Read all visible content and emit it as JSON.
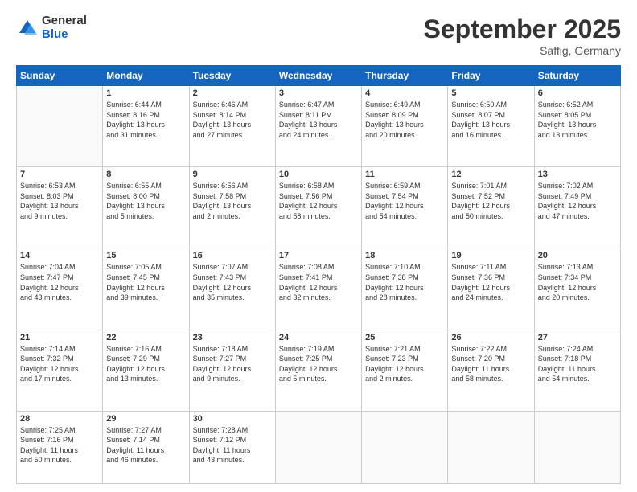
{
  "logo": {
    "general": "General",
    "blue": "Blue"
  },
  "title": "September 2025",
  "location": "Saffig, Germany",
  "days_header": [
    "Sunday",
    "Monday",
    "Tuesday",
    "Wednesday",
    "Thursday",
    "Friday",
    "Saturday"
  ],
  "weeks": [
    [
      {
        "day": "",
        "info": ""
      },
      {
        "day": "1",
        "info": "Sunrise: 6:44 AM\nSunset: 8:16 PM\nDaylight: 13 hours\nand 31 minutes."
      },
      {
        "day": "2",
        "info": "Sunrise: 6:46 AM\nSunset: 8:14 PM\nDaylight: 13 hours\nand 27 minutes."
      },
      {
        "day": "3",
        "info": "Sunrise: 6:47 AM\nSunset: 8:11 PM\nDaylight: 13 hours\nand 24 minutes."
      },
      {
        "day": "4",
        "info": "Sunrise: 6:49 AM\nSunset: 8:09 PM\nDaylight: 13 hours\nand 20 minutes."
      },
      {
        "day": "5",
        "info": "Sunrise: 6:50 AM\nSunset: 8:07 PM\nDaylight: 13 hours\nand 16 minutes."
      },
      {
        "day": "6",
        "info": "Sunrise: 6:52 AM\nSunset: 8:05 PM\nDaylight: 13 hours\nand 13 minutes."
      }
    ],
    [
      {
        "day": "7",
        "info": "Sunrise: 6:53 AM\nSunset: 8:03 PM\nDaylight: 13 hours\nand 9 minutes."
      },
      {
        "day": "8",
        "info": "Sunrise: 6:55 AM\nSunset: 8:00 PM\nDaylight: 13 hours\nand 5 minutes."
      },
      {
        "day": "9",
        "info": "Sunrise: 6:56 AM\nSunset: 7:58 PM\nDaylight: 13 hours\nand 2 minutes."
      },
      {
        "day": "10",
        "info": "Sunrise: 6:58 AM\nSunset: 7:56 PM\nDaylight: 12 hours\nand 58 minutes."
      },
      {
        "day": "11",
        "info": "Sunrise: 6:59 AM\nSunset: 7:54 PM\nDaylight: 12 hours\nand 54 minutes."
      },
      {
        "day": "12",
        "info": "Sunrise: 7:01 AM\nSunset: 7:52 PM\nDaylight: 12 hours\nand 50 minutes."
      },
      {
        "day": "13",
        "info": "Sunrise: 7:02 AM\nSunset: 7:49 PM\nDaylight: 12 hours\nand 47 minutes."
      }
    ],
    [
      {
        "day": "14",
        "info": "Sunrise: 7:04 AM\nSunset: 7:47 PM\nDaylight: 12 hours\nand 43 minutes."
      },
      {
        "day": "15",
        "info": "Sunrise: 7:05 AM\nSunset: 7:45 PM\nDaylight: 12 hours\nand 39 minutes."
      },
      {
        "day": "16",
        "info": "Sunrise: 7:07 AM\nSunset: 7:43 PM\nDaylight: 12 hours\nand 35 minutes."
      },
      {
        "day": "17",
        "info": "Sunrise: 7:08 AM\nSunset: 7:41 PM\nDaylight: 12 hours\nand 32 minutes."
      },
      {
        "day": "18",
        "info": "Sunrise: 7:10 AM\nSunset: 7:38 PM\nDaylight: 12 hours\nand 28 minutes."
      },
      {
        "day": "19",
        "info": "Sunrise: 7:11 AM\nSunset: 7:36 PM\nDaylight: 12 hours\nand 24 minutes."
      },
      {
        "day": "20",
        "info": "Sunrise: 7:13 AM\nSunset: 7:34 PM\nDaylight: 12 hours\nand 20 minutes."
      }
    ],
    [
      {
        "day": "21",
        "info": "Sunrise: 7:14 AM\nSunset: 7:32 PM\nDaylight: 12 hours\nand 17 minutes."
      },
      {
        "day": "22",
        "info": "Sunrise: 7:16 AM\nSunset: 7:29 PM\nDaylight: 12 hours\nand 13 minutes."
      },
      {
        "day": "23",
        "info": "Sunrise: 7:18 AM\nSunset: 7:27 PM\nDaylight: 12 hours\nand 9 minutes."
      },
      {
        "day": "24",
        "info": "Sunrise: 7:19 AM\nSunset: 7:25 PM\nDaylight: 12 hours\nand 5 minutes."
      },
      {
        "day": "25",
        "info": "Sunrise: 7:21 AM\nSunset: 7:23 PM\nDaylight: 12 hours\nand 2 minutes."
      },
      {
        "day": "26",
        "info": "Sunrise: 7:22 AM\nSunset: 7:20 PM\nDaylight: 11 hours\nand 58 minutes."
      },
      {
        "day": "27",
        "info": "Sunrise: 7:24 AM\nSunset: 7:18 PM\nDaylight: 11 hours\nand 54 minutes."
      }
    ],
    [
      {
        "day": "28",
        "info": "Sunrise: 7:25 AM\nSunset: 7:16 PM\nDaylight: 11 hours\nand 50 minutes."
      },
      {
        "day": "29",
        "info": "Sunrise: 7:27 AM\nSunset: 7:14 PM\nDaylight: 11 hours\nand 46 minutes."
      },
      {
        "day": "30",
        "info": "Sunrise: 7:28 AM\nSunset: 7:12 PM\nDaylight: 11 hours\nand 43 minutes."
      },
      {
        "day": "",
        "info": ""
      },
      {
        "day": "",
        "info": ""
      },
      {
        "day": "",
        "info": ""
      },
      {
        "day": "",
        "info": ""
      }
    ]
  ]
}
